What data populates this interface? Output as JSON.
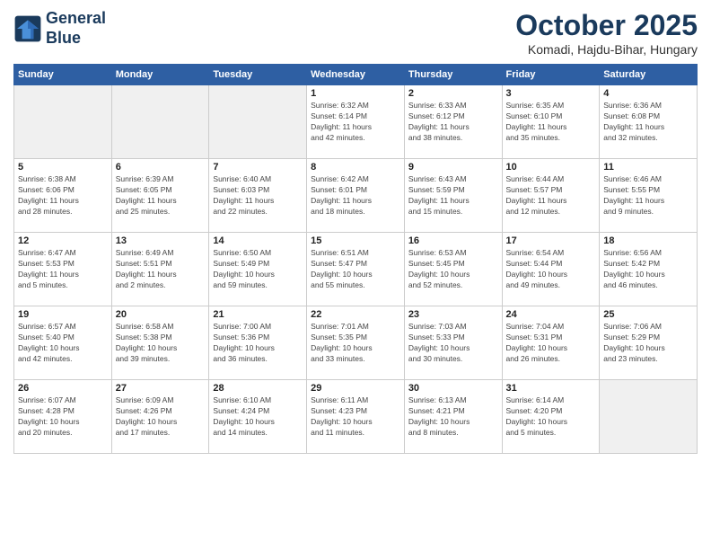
{
  "header": {
    "logo_line1": "General",
    "logo_line2": "Blue",
    "month": "October 2025",
    "location": "Komadi, Hajdu-Bihar, Hungary"
  },
  "weekdays": [
    "Sunday",
    "Monday",
    "Tuesday",
    "Wednesday",
    "Thursday",
    "Friday",
    "Saturday"
  ],
  "weeks": [
    [
      {
        "day": "",
        "info": "",
        "empty": true
      },
      {
        "day": "",
        "info": "",
        "empty": true
      },
      {
        "day": "",
        "info": "",
        "empty": true
      },
      {
        "day": "1",
        "info": "Sunrise: 6:32 AM\nSunset: 6:14 PM\nDaylight: 11 hours\nand 42 minutes."
      },
      {
        "day": "2",
        "info": "Sunrise: 6:33 AM\nSunset: 6:12 PM\nDaylight: 11 hours\nand 38 minutes."
      },
      {
        "day": "3",
        "info": "Sunrise: 6:35 AM\nSunset: 6:10 PM\nDaylight: 11 hours\nand 35 minutes."
      },
      {
        "day": "4",
        "info": "Sunrise: 6:36 AM\nSunset: 6:08 PM\nDaylight: 11 hours\nand 32 minutes."
      }
    ],
    [
      {
        "day": "5",
        "info": "Sunrise: 6:38 AM\nSunset: 6:06 PM\nDaylight: 11 hours\nand 28 minutes."
      },
      {
        "day": "6",
        "info": "Sunrise: 6:39 AM\nSunset: 6:05 PM\nDaylight: 11 hours\nand 25 minutes."
      },
      {
        "day": "7",
        "info": "Sunrise: 6:40 AM\nSunset: 6:03 PM\nDaylight: 11 hours\nand 22 minutes."
      },
      {
        "day": "8",
        "info": "Sunrise: 6:42 AM\nSunset: 6:01 PM\nDaylight: 11 hours\nand 18 minutes."
      },
      {
        "day": "9",
        "info": "Sunrise: 6:43 AM\nSunset: 5:59 PM\nDaylight: 11 hours\nand 15 minutes."
      },
      {
        "day": "10",
        "info": "Sunrise: 6:44 AM\nSunset: 5:57 PM\nDaylight: 11 hours\nand 12 minutes."
      },
      {
        "day": "11",
        "info": "Sunrise: 6:46 AM\nSunset: 5:55 PM\nDaylight: 11 hours\nand 9 minutes."
      }
    ],
    [
      {
        "day": "12",
        "info": "Sunrise: 6:47 AM\nSunset: 5:53 PM\nDaylight: 11 hours\nand 5 minutes."
      },
      {
        "day": "13",
        "info": "Sunrise: 6:49 AM\nSunset: 5:51 PM\nDaylight: 11 hours\nand 2 minutes."
      },
      {
        "day": "14",
        "info": "Sunrise: 6:50 AM\nSunset: 5:49 PM\nDaylight: 10 hours\nand 59 minutes."
      },
      {
        "day": "15",
        "info": "Sunrise: 6:51 AM\nSunset: 5:47 PM\nDaylight: 10 hours\nand 55 minutes."
      },
      {
        "day": "16",
        "info": "Sunrise: 6:53 AM\nSunset: 5:45 PM\nDaylight: 10 hours\nand 52 minutes."
      },
      {
        "day": "17",
        "info": "Sunrise: 6:54 AM\nSunset: 5:44 PM\nDaylight: 10 hours\nand 49 minutes."
      },
      {
        "day": "18",
        "info": "Sunrise: 6:56 AM\nSunset: 5:42 PM\nDaylight: 10 hours\nand 46 minutes."
      }
    ],
    [
      {
        "day": "19",
        "info": "Sunrise: 6:57 AM\nSunset: 5:40 PM\nDaylight: 10 hours\nand 42 minutes."
      },
      {
        "day": "20",
        "info": "Sunrise: 6:58 AM\nSunset: 5:38 PM\nDaylight: 10 hours\nand 39 minutes."
      },
      {
        "day": "21",
        "info": "Sunrise: 7:00 AM\nSunset: 5:36 PM\nDaylight: 10 hours\nand 36 minutes."
      },
      {
        "day": "22",
        "info": "Sunrise: 7:01 AM\nSunset: 5:35 PM\nDaylight: 10 hours\nand 33 minutes."
      },
      {
        "day": "23",
        "info": "Sunrise: 7:03 AM\nSunset: 5:33 PM\nDaylight: 10 hours\nand 30 minutes."
      },
      {
        "day": "24",
        "info": "Sunrise: 7:04 AM\nSunset: 5:31 PM\nDaylight: 10 hours\nand 26 minutes."
      },
      {
        "day": "25",
        "info": "Sunrise: 7:06 AM\nSunset: 5:29 PM\nDaylight: 10 hours\nand 23 minutes."
      }
    ],
    [
      {
        "day": "26",
        "info": "Sunrise: 6:07 AM\nSunset: 4:28 PM\nDaylight: 10 hours\nand 20 minutes."
      },
      {
        "day": "27",
        "info": "Sunrise: 6:09 AM\nSunset: 4:26 PM\nDaylight: 10 hours\nand 17 minutes."
      },
      {
        "day": "28",
        "info": "Sunrise: 6:10 AM\nSunset: 4:24 PM\nDaylight: 10 hours\nand 14 minutes."
      },
      {
        "day": "29",
        "info": "Sunrise: 6:11 AM\nSunset: 4:23 PM\nDaylight: 10 hours\nand 11 minutes."
      },
      {
        "day": "30",
        "info": "Sunrise: 6:13 AM\nSunset: 4:21 PM\nDaylight: 10 hours\nand 8 minutes."
      },
      {
        "day": "31",
        "info": "Sunrise: 6:14 AM\nSunset: 4:20 PM\nDaylight: 10 hours\nand 5 minutes."
      },
      {
        "day": "",
        "info": "",
        "empty": true
      }
    ]
  ]
}
